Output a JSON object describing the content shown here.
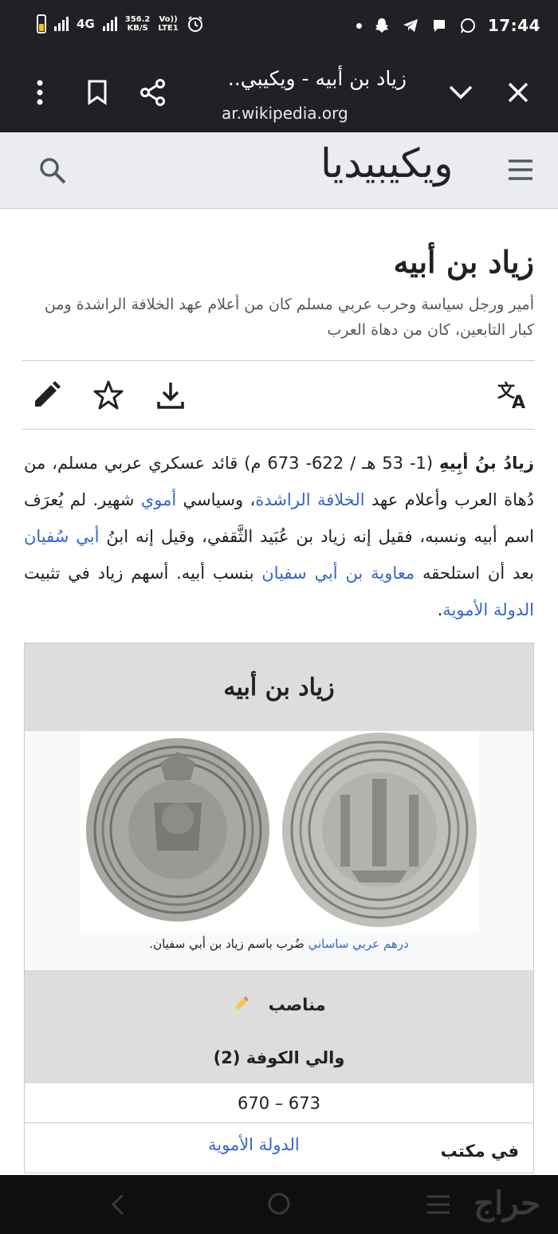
{
  "status_bar": {
    "network": "4G",
    "speed_value": "356.2",
    "speed_unit": "KB/S",
    "volte_top": "Vo))",
    "volte_bottom": "LTE1",
    "time": "17:44",
    "battery_color": "#f6c21c"
  },
  "browser": {
    "tab_title": "زياد بن أبيه - ويكيبي..",
    "url": "ar.wikipedia.org"
  },
  "wiki_header": {
    "logo_text": "ويكيبيديا"
  },
  "article": {
    "title": "زياد بن أبيه",
    "short_description": "أمير ورجل سياسة وحرب عربي مسلم كان من أعلام عهد الخلافة الراشدة ومن كبار التابعين، كان من دهاة العرب",
    "lead": {
      "name_bold": "زيادُ بنُ أبِيهِ",
      "s1": " (1- 53 هـ / 622- 673 م) قائد عسكري عربي مسلم، من دُهاة العرب وأعلام عهد ",
      "link_rashidun": "الخلافة الراشدة",
      "s2": "، وسياسي ",
      "link_umayyad_adj": "أموي",
      "s3": " شهير. لم يُعرَف اسم أبيه ونسبه، فقيل إنه زياد بن عُبَيد الثَّقفي، وقيل إنه ابنُ ",
      "link_abu_sufyan": "أبي سُفيان",
      "s4": " بعد أن استلحقه ",
      "link_muawiya": "معاوية بن أبي سفيان",
      "s5": " بنسب أبيه. أسهم زياد في تثبيت ",
      "link_umayyad_state": "الدولة الأموية",
      "s6": "."
    }
  },
  "infobox": {
    "title": "زياد بن أبيه",
    "caption_link": "درهم عربي ساساني",
    "caption_rest": " ضُرب باسم زياد بن أبي سفيان.",
    "section_heading": "مناصب",
    "position_title": "والي الكوفة (2)",
    "term": "670 – 673",
    "in_office_label": "في مكتب",
    "in_office_value": "الدولة الأموية"
  },
  "navbar": {
    "watermark": "حراج"
  },
  "colors": {
    "link": "#3366cc",
    "chrome": "#202124",
    "header_bg": "#eaecf0",
    "infobox_header": "#dddddd"
  },
  "icons": [
    "battery-icon",
    "signal-icon",
    "alarm-icon",
    "dot-icon",
    "snapchat-icon",
    "telegram-icon",
    "message-icon",
    "whatsapp-icon",
    "more-vert-icon",
    "bookmark-icon",
    "share-icon",
    "chevron-down-icon",
    "close-icon",
    "search-icon",
    "menu-icon",
    "edit-icon",
    "star-icon",
    "download-icon",
    "translate-icon",
    "pencil-icon",
    "back-icon",
    "home-icon",
    "recents-icon"
  ]
}
